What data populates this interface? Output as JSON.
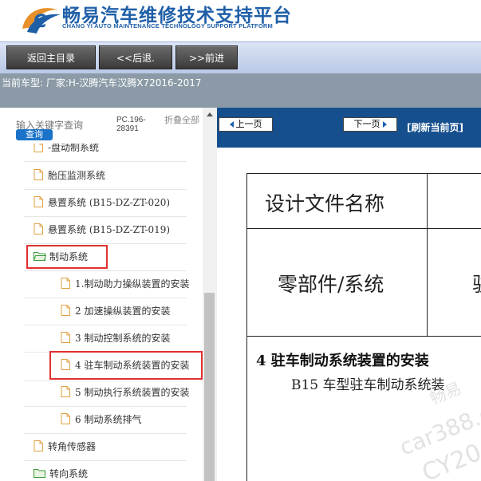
{
  "header": {
    "title_cn": "畅易汽车维修技术支持平台",
    "title_en": "CHANG YI AUTO MAINTENANCE TECHNOLOGY SUPPORT PLATFORM"
  },
  "toolbar": {
    "home_label": "返回主目录",
    "back_label": "<<后退.",
    "forward_label": ">>前进"
  },
  "vehicle": {
    "text": "当前车型:  厂家:H-汉腾汽车汉腾X72016-2017"
  },
  "search": {
    "placeholder": "输入关键字查询",
    "button_label": "查询",
    "pc_code": "PC.196-28391",
    "collapse_label": "折叠全部"
  },
  "tree": {
    "items": [
      {
        "label": "-盘动制系统",
        "kind": "file"
      },
      {
        "label": "胎压监测系统",
        "kind": "file"
      },
      {
        "label": "悬置系统 (B15-DZ-ZT-020)",
        "kind": "file"
      },
      {
        "label": "悬置系统 (B15-DZ-ZT-019)",
        "kind": "file"
      },
      {
        "label": "制动系统",
        "kind": "folder-open",
        "highlighted": true
      },
      {
        "label": "1.制动助力操纵装置的安装",
        "kind": "file"
      },
      {
        "label": "2 加速操纵装置的安装",
        "kind": "file"
      },
      {
        "label": "3 制动控制系统的安装",
        "kind": "file"
      },
      {
        "label": "4 驻车制动系统装置的安装",
        "kind": "file",
        "highlighted": true,
        "selected": true
      },
      {
        "label": "5 制动执行系统装置的安装",
        "kind": "file"
      },
      {
        "label": "6 制动系统排气",
        "kind": "file"
      },
      {
        "label": "转角传感器",
        "kind": "file"
      },
      {
        "label": "转向系统",
        "kind": "folder"
      }
    ]
  },
  "docnav": {
    "prev_label": "上一页",
    "next_label": "下一页",
    "refresh_label": "[刷新当前页]"
  },
  "document": {
    "row1_label": "设计文件名称",
    "row2_label": "零部件/系统",
    "row2_value_partial": "驻",
    "heading": "4 驻车制动系统装置的安装",
    "subline": "B15 车型驻车制动系统装",
    "watermark_1": "畅易",
    "watermark_2": "car388.c",
    "watermark_3": "CY20"
  },
  "colors": {
    "brand_blue": "#1f5fa8",
    "nav_blue": "#164f8e",
    "highlight_red": "#e03030",
    "vehicle_bar": "#8b9aa6"
  }
}
